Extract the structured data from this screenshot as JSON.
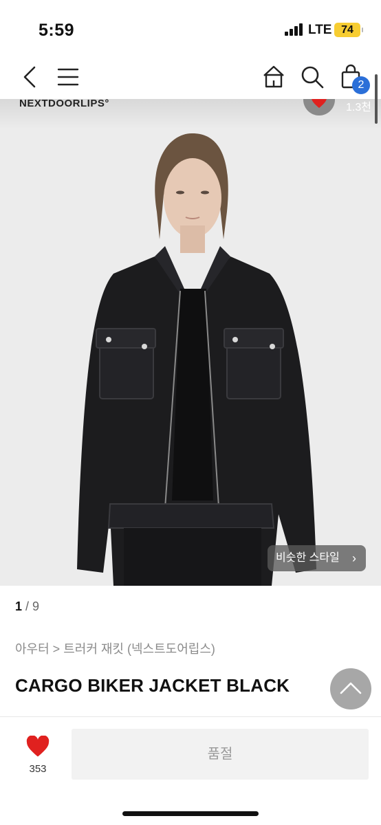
{
  "status_bar": {
    "time": "5:59",
    "network": "LTE",
    "battery": "74"
  },
  "nav": {
    "icons": [
      "back-icon",
      "menu-icon",
      "home-icon",
      "search-icon",
      "cart-icon"
    ],
    "cart_count": "2"
  },
  "brand": {
    "logo_text": "NEXTDOORLIPS°",
    "like_count": "1.3천"
  },
  "gallery": {
    "current": "1",
    "separator": " / ",
    "total": "9",
    "similar_style_label": "비슷한 스타일"
  },
  "product": {
    "breadcrumb": "아우터 > 트러커 재킷 (넥스트도어립스)",
    "title": "CARGO BIKER JACKET BLACK"
  },
  "bottom_bar": {
    "like_count": "353",
    "soldout_label": "품절"
  },
  "colors": {
    "heart_red": "#e0211f",
    "badge_blue": "#2b6fd8",
    "battery_yellow": "#f7cd32"
  }
}
